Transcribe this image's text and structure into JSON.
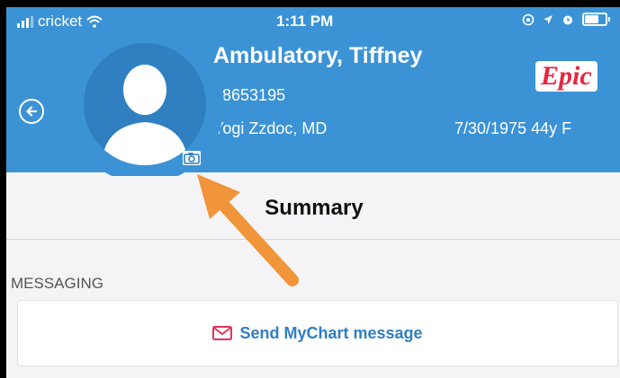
{
  "status_bar": {
    "carrier": "cricket",
    "time": "1:11 PM",
    "icons": [
      "signal-icon",
      "wifi-icon",
      "lock-rotation-icon",
      "location-icon",
      "alarm-icon",
      "battery-icon"
    ]
  },
  "patient": {
    "name": "Ambulatory, Tiffney",
    "mrn": "58653195",
    "provider": "Yogi Zzdoc, MD",
    "dob_age_sex": "7/30/1975 44y F"
  },
  "brand": {
    "logo": "Epic",
    "color": "#e8253e"
  },
  "header": {
    "color": "#3b93d6",
    "back_icon": "back-arrow-icon"
  },
  "page": {
    "title": "Summary"
  },
  "messaging": {
    "section_label": "MESSAGING",
    "button_label": "Send MyChart message",
    "button_icon": "mail-icon",
    "accent": "#2f7fc1",
    "icon_color": "#e2345a"
  },
  "annotation": {
    "arrow_color": "#f0953a"
  }
}
